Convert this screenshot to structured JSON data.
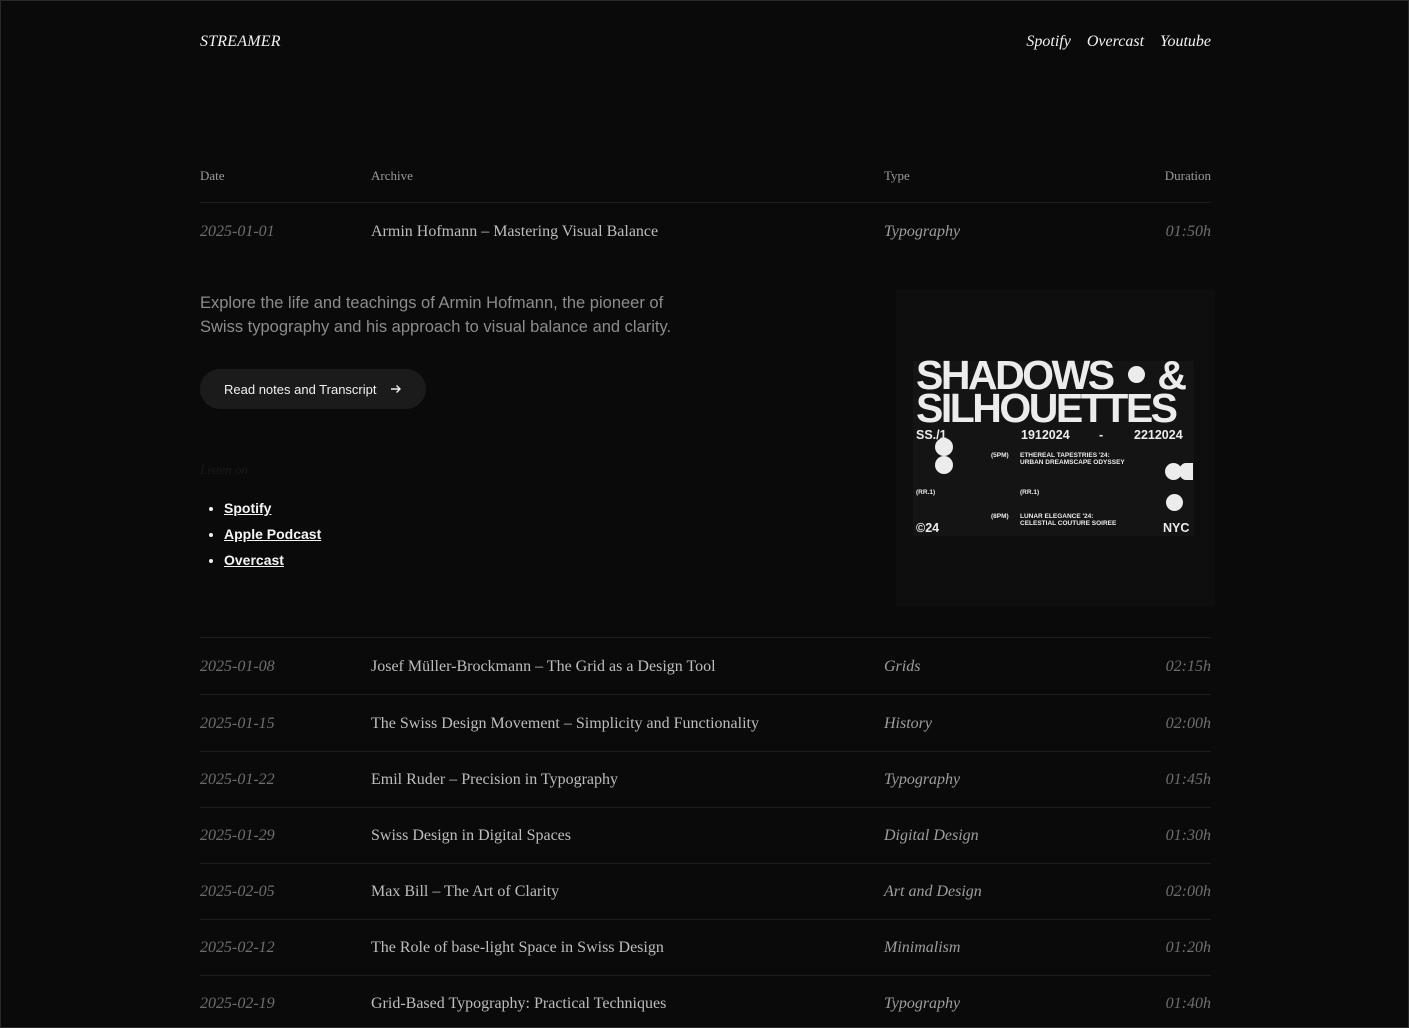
{
  "brand": "STREAMER",
  "nav": [
    "Spotify",
    "Overcast",
    "Youtube"
  ],
  "table": {
    "headers": {
      "date": "Date",
      "archive": "Archive",
      "type": "Type",
      "duration": "Duration"
    }
  },
  "episodes": [
    {
      "date": "2025-01-01",
      "title": "Armin Hofmann – Mastering Visual Balance",
      "type": "Typography",
      "duration": "01:50h"
    },
    {
      "date": "2025-01-08",
      "title": "Josef Müller-Brockmann – The Grid as a Design Tool",
      "type": "Grids",
      "duration": "02:15h"
    },
    {
      "date": "2025-01-15",
      "title": "The Swiss Design Movement – Simplicity and Functionality",
      "type": "History",
      "duration": "02:00h"
    },
    {
      "date": "2025-01-22",
      "title": "Emil Ruder – Precision in Typography",
      "type": "Typography",
      "duration": "01:45h"
    },
    {
      "date": "2025-01-29",
      "title": "Swiss Design in Digital Spaces",
      "type": "Digital Design",
      "duration": "01:30h"
    },
    {
      "date": "2025-02-05",
      "title": "Max Bill – The Art of Clarity",
      "type": "Art and Design",
      "duration": "02:00h"
    },
    {
      "date": "2025-02-12",
      "title": "The Role of base-light Space in Swiss Design",
      "type": "Minimalism",
      "duration": "01:20h"
    },
    {
      "date": "2025-02-19",
      "title": "Grid-Based Typography: Practical Techniques",
      "type": "Typography",
      "duration": "01:40h"
    }
  ],
  "expanded": {
    "description": "Explore the life and teachings of Armin Hofmann, the pioneer of Swiss typography and his approach to visual balance and clarity.",
    "cta_label": "Read notes and Transcript",
    "cta_icon": "arrow-right-icon",
    "listen_label": "Listen on",
    "links": [
      "Spotify",
      "Apple Podcast",
      "Overcast"
    ],
    "poster": {
      "title_line1": "SHADOWS",
      "title_amp": "&",
      "title_line2": "SILHOUETTES",
      "ss": "SS./1",
      "date_start": "1912024",
      "date_dash": "-",
      "date_end": "2212024",
      "time1": "(5PM)",
      "event1": "ETHEREAL TAPESTRIES '24: URBAN DREAMSCAPE ODYSSEY",
      "rr_left": "(RR.1)",
      "rr_right": "(RR.1)",
      "time2": "(8PM)",
      "event2": "LUNAR ELEGANCE '24: CELESTIAL COUTURE SOIREE",
      "copyright": "©24",
      "city": "NYC"
    }
  }
}
